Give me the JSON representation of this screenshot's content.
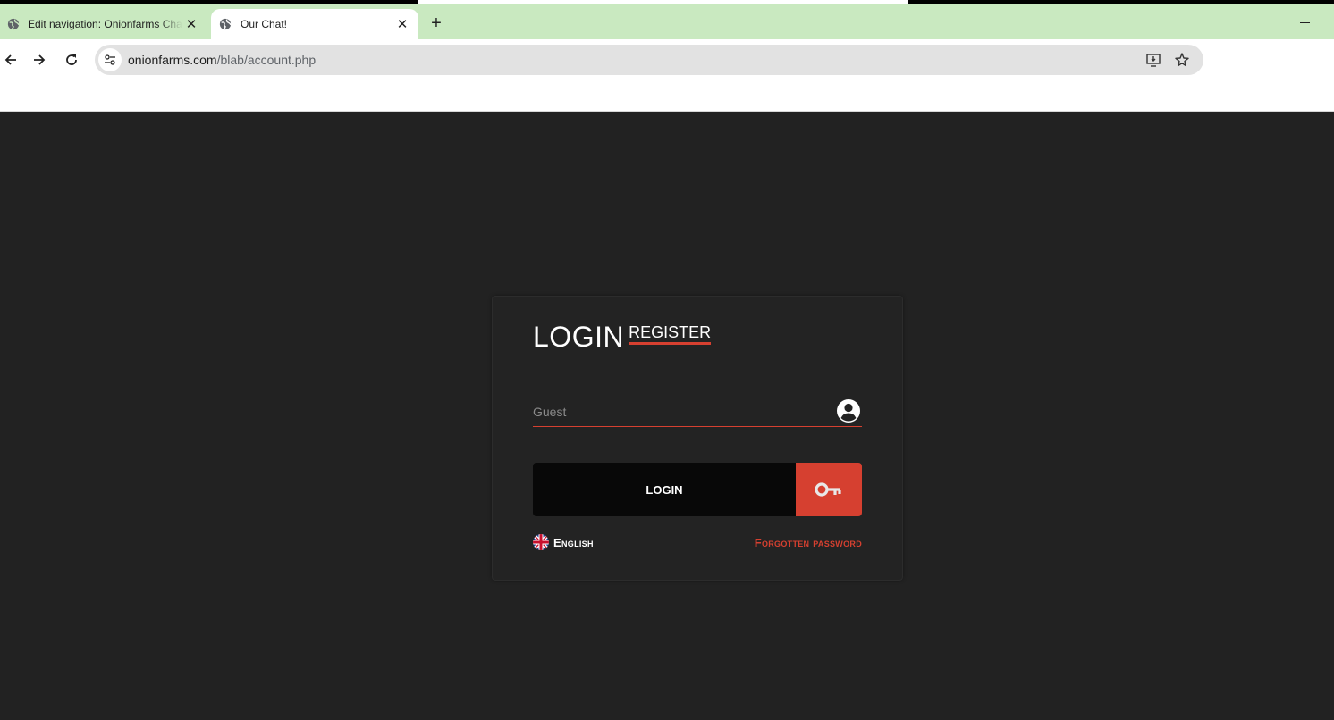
{
  "browser": {
    "tabs": [
      {
        "title": "Edit navigation: Onionfarms Chat",
        "active": false
      },
      {
        "title": "Our Chat!",
        "active": true
      }
    ],
    "new_tab_label": "+",
    "url_host": "onionfarms.com",
    "url_path": "/blab/account.php"
  },
  "login_card": {
    "title": "LOGIN",
    "register_link": "REGISTER",
    "username_placeholder": "Guest",
    "username_value": "",
    "login_button": "LOGIN",
    "language": "English",
    "forgot_password": "Forgotten password",
    "accent_color": "#d64030"
  },
  "icons": {
    "tab_favicon": "globe-icon",
    "user_field": "user-circle-icon",
    "login_button": "key-icon",
    "language_flag": "uk-flag-icon"
  }
}
